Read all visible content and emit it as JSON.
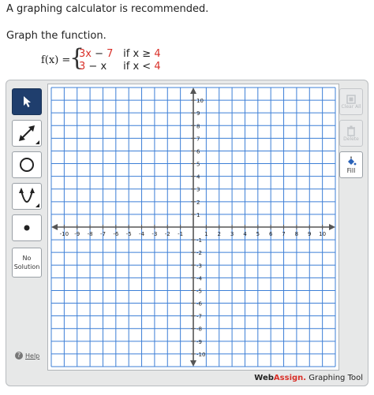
{
  "intro_text": "A graphing calculator is recommended.",
  "prompt_text": "Graph the function.",
  "function": {
    "lhs": "f(x) =",
    "pieces": [
      {
        "expr_red1": "3x",
        "expr_mid": " − ",
        "expr_red2": "7",
        "cond_black": "if x ≥ ",
        "cond_red": "4"
      },
      {
        "expr_red1": "3",
        "expr_mid": " − x",
        "expr_red2": "",
        "cond_black": "if x < ",
        "cond_red": "4"
      }
    ]
  },
  "toolbar": {
    "no_solution_line1": "No",
    "no_solution_line2": "Solution",
    "help_label": "Help"
  },
  "right_toolbar": {
    "clear_all_label": "Clear All",
    "delete_label": "Delete",
    "fill_label": "Fill"
  },
  "graph": {
    "xmin": -11,
    "xmax": 11,
    "ymin": -11,
    "ymax": 11,
    "x_ticks": [
      -10,
      -9,
      -8,
      -7,
      -6,
      -5,
      -4,
      -3,
      -2,
      -1,
      1,
      2,
      3,
      4,
      5,
      6,
      7,
      8,
      9,
      10
    ],
    "y_ticks": [
      -10,
      -9,
      -8,
      -7,
      -6,
      -5,
      -4,
      -3,
      -2,
      -1,
      1,
      2,
      3,
      4,
      5,
      6,
      7,
      8,
      9,
      10
    ],
    "grid_color": "#3d7fd6",
    "axis_color": "#555555"
  },
  "branding": {
    "part1": "Web",
    "part2": "Assign.",
    "part3": " Graphing Tool"
  }
}
